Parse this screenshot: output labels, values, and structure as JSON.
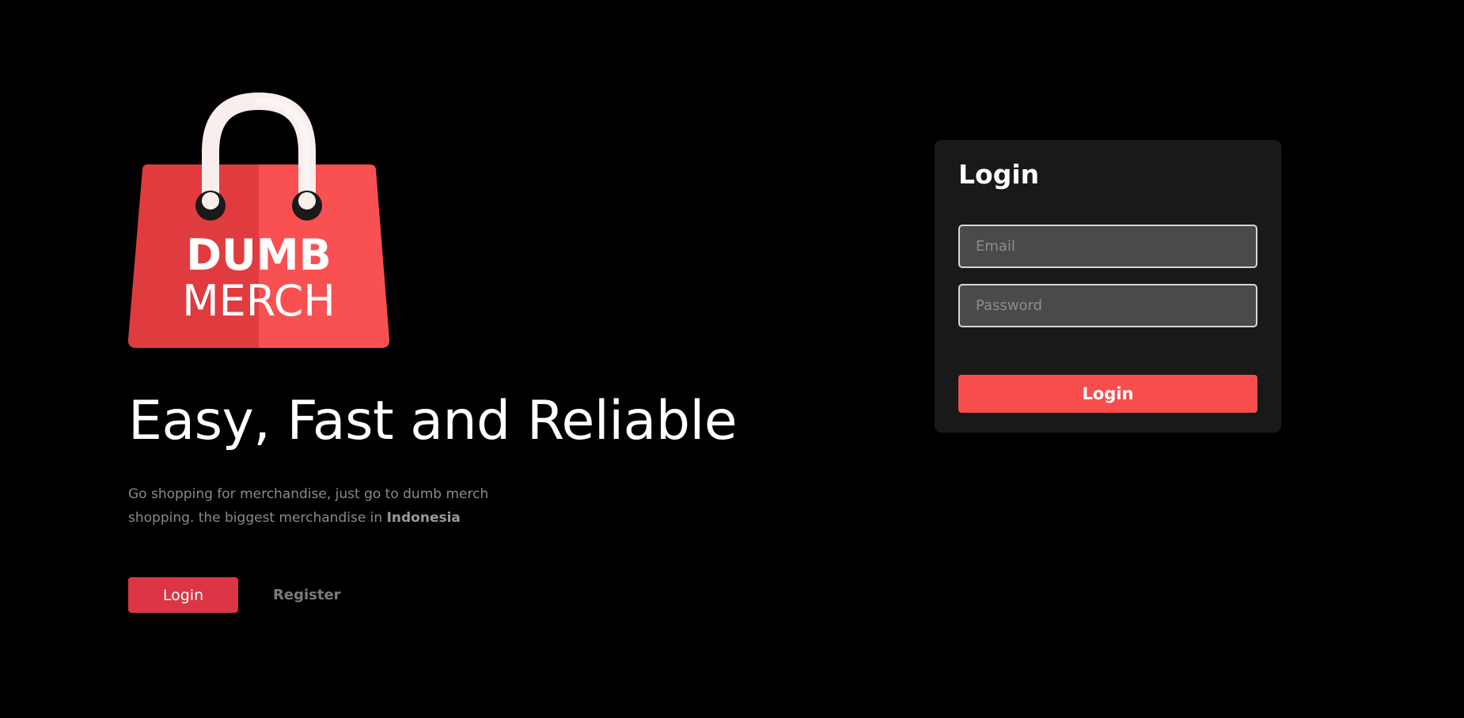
{
  "brand": {
    "logo_line1": "DUMB",
    "logo_line2": "MERCH",
    "logo_color_light": "#f95052",
    "logo_color_dark": "#e03c40",
    "handle_color": "#f8eeec",
    "ring_color": "#1a1a1a"
  },
  "hero": {
    "headline": "Easy, Fast and Reliable",
    "description_prefix": "Go shopping for merchandise, just go to dumb merch shopping. the biggest merchandise in ",
    "description_highlight": "Indonesia",
    "login_label": "Login",
    "register_label": "Register"
  },
  "login_card": {
    "title": "Login",
    "email_placeholder": "Email",
    "password_placeholder": "Password",
    "submit_label": "Login"
  },
  "colors": {
    "background": "#000000",
    "card_background": "#191919",
    "accent": "#f74d4d",
    "hero_button": "#dc3545"
  }
}
